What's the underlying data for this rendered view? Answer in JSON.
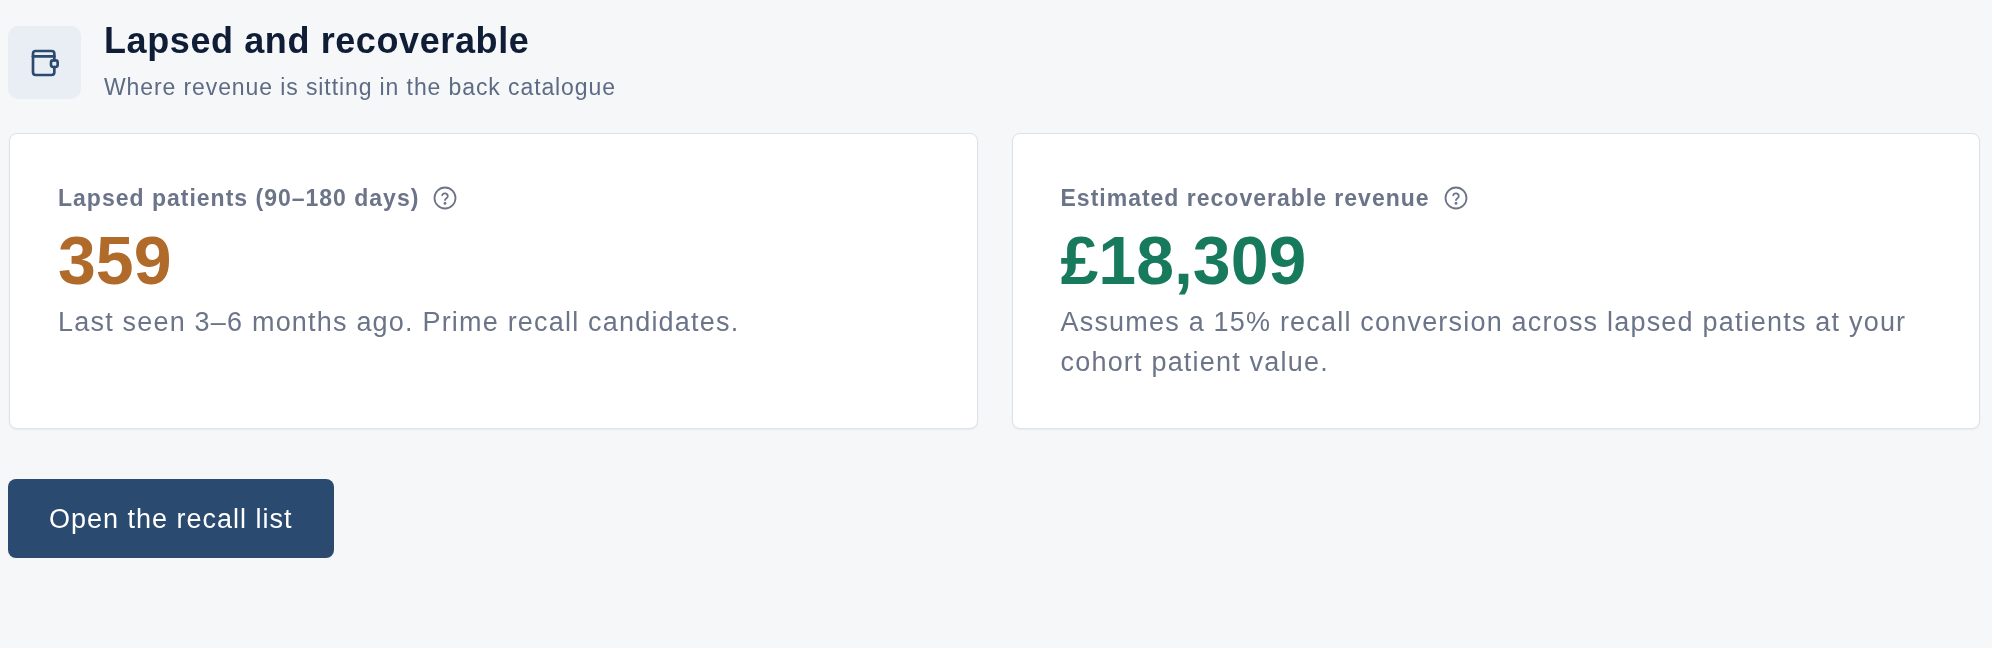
{
  "header": {
    "title": "Lapsed and recoverable",
    "subtitle": "Where revenue is sitting in the back catalogue"
  },
  "cards": [
    {
      "label": "Lapsed patients (90–180 days)",
      "value": "359",
      "color": "#b06a29",
      "description": "Last seen 3–6 months ago. Prime recall candidates."
    },
    {
      "label": "Estimated recoverable revenue",
      "value": "£18,309",
      "color": "#177a5d",
      "description": "Assumes a 15% recall conversion across lapsed patients at your cohort patient value."
    }
  ],
  "button": {
    "label": "Open the recall list"
  }
}
